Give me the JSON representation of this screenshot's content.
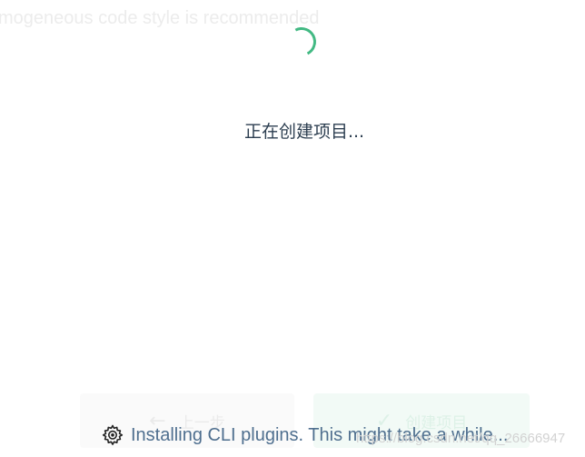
{
  "background_text": "mogeneous code style is recommended",
  "status": {
    "title": "正在创建项目..."
  },
  "buttons": {
    "prev_icon": "←",
    "prev_label": "上一步",
    "create_icon": "✓",
    "create_label": "创建项目"
  },
  "progress": {
    "icon": "gear-icon",
    "message": "Installing CLI plugins. This might take a while..."
  },
  "watermark": "https://blog.csdn.net/qq_26666947",
  "colors": {
    "accent": "#42b983",
    "progress_text": "#4f6f8f",
    "title_text": "#2c3e50"
  }
}
